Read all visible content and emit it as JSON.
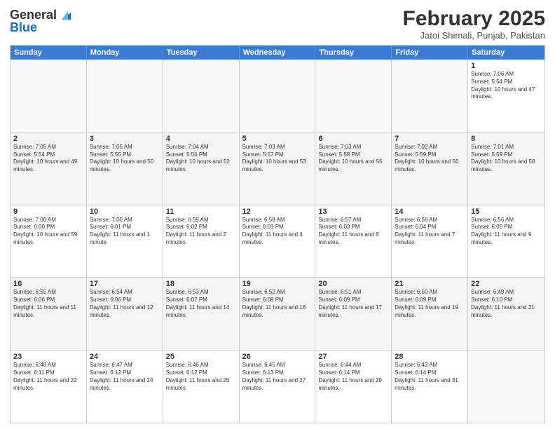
{
  "header": {
    "logo_general": "General",
    "logo_blue": "Blue",
    "month_title": "February 2025",
    "location": "Jatoi Shimali, Punjab, Pakistan"
  },
  "weekdays": [
    "Sunday",
    "Monday",
    "Tuesday",
    "Wednesday",
    "Thursday",
    "Friday",
    "Saturday"
  ],
  "rows": [
    [
      {
        "day": "",
        "info": ""
      },
      {
        "day": "",
        "info": ""
      },
      {
        "day": "",
        "info": ""
      },
      {
        "day": "",
        "info": ""
      },
      {
        "day": "",
        "info": ""
      },
      {
        "day": "",
        "info": ""
      },
      {
        "day": "1",
        "info": "Sunrise: 7:06 AM\nSunset: 5:54 PM\nDaylight: 10 hours and 47 minutes."
      }
    ],
    [
      {
        "day": "2",
        "info": "Sunrise: 7:05 AM\nSunset: 5:54 PM\nDaylight: 10 hours and 49 minutes."
      },
      {
        "day": "3",
        "info": "Sunrise: 7:05 AM\nSunset: 5:55 PM\nDaylight: 10 hours and 50 minutes."
      },
      {
        "day": "4",
        "info": "Sunrise: 7:04 AM\nSunset: 5:56 PM\nDaylight: 10 hours and 52 minutes."
      },
      {
        "day": "5",
        "info": "Sunrise: 7:03 AM\nSunset: 5:57 PM\nDaylight: 10 hours and 53 minutes."
      },
      {
        "day": "6",
        "info": "Sunrise: 7:03 AM\nSunset: 5:58 PM\nDaylight: 10 hours and 55 minutes."
      },
      {
        "day": "7",
        "info": "Sunrise: 7:02 AM\nSunset: 5:59 PM\nDaylight: 10 hours and 56 minutes."
      },
      {
        "day": "8",
        "info": "Sunrise: 7:01 AM\nSunset: 5:59 PM\nDaylight: 10 hours and 58 minutes."
      }
    ],
    [
      {
        "day": "9",
        "info": "Sunrise: 7:00 AM\nSunset: 6:00 PM\nDaylight: 10 hours and 59 minutes."
      },
      {
        "day": "10",
        "info": "Sunrise: 7:00 AM\nSunset: 6:01 PM\nDaylight: 11 hours and 1 minute."
      },
      {
        "day": "11",
        "info": "Sunrise: 6:59 AM\nSunset: 6:02 PM\nDaylight: 11 hours and 2 minutes."
      },
      {
        "day": "12",
        "info": "Sunrise: 6:58 AM\nSunset: 6:03 PM\nDaylight: 11 hours and 4 minutes."
      },
      {
        "day": "13",
        "info": "Sunrise: 6:57 AM\nSunset: 6:03 PM\nDaylight: 11 hours and 6 minutes."
      },
      {
        "day": "14",
        "info": "Sunrise: 6:56 AM\nSunset: 6:04 PM\nDaylight: 11 hours and 7 minutes."
      },
      {
        "day": "15",
        "info": "Sunrise: 6:56 AM\nSunset: 6:05 PM\nDaylight: 11 hours and 9 minutes."
      }
    ],
    [
      {
        "day": "16",
        "info": "Sunrise: 6:55 AM\nSunset: 6:06 PM\nDaylight: 11 hours and 11 minutes."
      },
      {
        "day": "17",
        "info": "Sunrise: 6:54 AM\nSunset: 6:06 PM\nDaylight: 11 hours and 12 minutes."
      },
      {
        "day": "18",
        "info": "Sunrise: 6:53 AM\nSunset: 6:07 PM\nDaylight: 11 hours and 14 minutes."
      },
      {
        "day": "19",
        "info": "Sunrise: 6:52 AM\nSunset: 6:08 PM\nDaylight: 11 hours and 16 minutes."
      },
      {
        "day": "20",
        "info": "Sunrise: 6:51 AM\nSunset: 6:09 PM\nDaylight: 11 hours and 17 minutes."
      },
      {
        "day": "21",
        "info": "Sunrise: 6:50 AM\nSunset: 6:09 PM\nDaylight: 11 hours and 19 minutes."
      },
      {
        "day": "22",
        "info": "Sunrise: 6:49 AM\nSunset: 6:10 PM\nDaylight: 11 hours and 21 minutes."
      }
    ],
    [
      {
        "day": "23",
        "info": "Sunrise: 6:48 AM\nSunset: 6:11 PM\nDaylight: 11 hours and 22 minutes."
      },
      {
        "day": "24",
        "info": "Sunrise: 6:47 AM\nSunset: 6:12 PM\nDaylight: 11 hours and 24 minutes."
      },
      {
        "day": "25",
        "info": "Sunrise: 6:46 AM\nSunset: 6:12 PM\nDaylight: 11 hours and 26 minutes."
      },
      {
        "day": "26",
        "info": "Sunrise: 6:45 AM\nSunset: 6:13 PM\nDaylight: 11 hours and 27 minutes."
      },
      {
        "day": "27",
        "info": "Sunrise: 6:44 AM\nSunset: 6:14 PM\nDaylight: 11 hours and 29 minutes."
      },
      {
        "day": "28",
        "info": "Sunrise: 6:43 AM\nSunset: 6:14 PM\nDaylight: 11 hours and 31 minutes."
      },
      {
        "day": "",
        "info": ""
      }
    ]
  ]
}
